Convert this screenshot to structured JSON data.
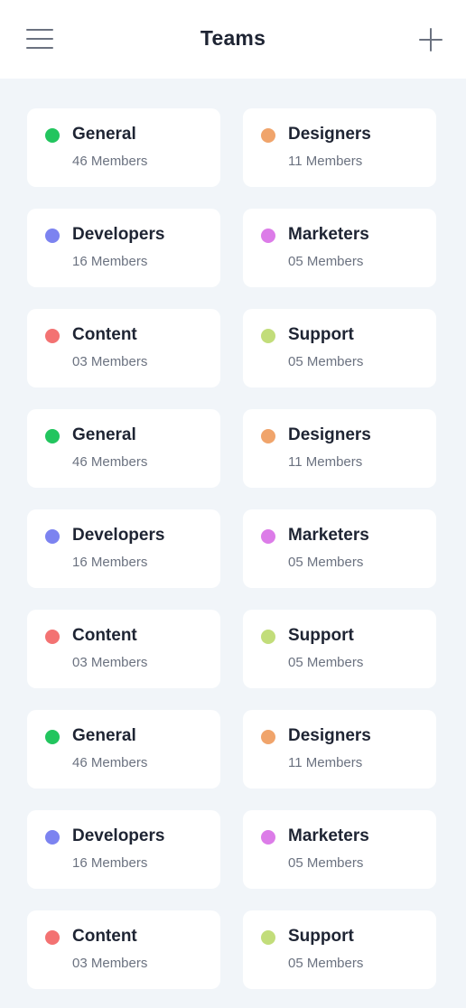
{
  "header": {
    "title": "Teams",
    "menu_icon": "hamburger-menu-icon",
    "add_icon": "plus-icon"
  },
  "teams": [
    {
      "name": "General",
      "members": "46 Members",
      "color": "#22c55e"
    },
    {
      "name": "Designers",
      "members": "11 Members",
      "color": "#f0a46b"
    },
    {
      "name": "Developers",
      "members": "16 Members",
      "color": "#7c83f0"
    },
    {
      "name": "Marketers",
      "members": "05 Members",
      "color": "#dc7ce8"
    },
    {
      "name": "Content",
      "members": "03 Members",
      "color": "#f37272"
    },
    {
      "name": "Support",
      "members": "05 Members",
      "color": "#c2dd7a"
    },
    {
      "name": "General",
      "members": "46 Members",
      "color": "#22c55e"
    },
    {
      "name": "Designers",
      "members": "11 Members",
      "color": "#f0a46b"
    },
    {
      "name": "Developers",
      "members": "16 Members",
      "color": "#7c83f0"
    },
    {
      "name": "Marketers",
      "members": "05 Members",
      "color": "#dc7ce8"
    },
    {
      "name": "Content",
      "members": "03 Members",
      "color": "#f37272"
    },
    {
      "name": "Support",
      "members": "05 Members",
      "color": "#c2dd7a"
    },
    {
      "name": "General",
      "members": "46 Members",
      "color": "#22c55e"
    },
    {
      "name": "Designers",
      "members": "11 Members",
      "color": "#f0a46b"
    },
    {
      "name": "Developers",
      "members": "16 Members",
      "color": "#7c83f0"
    },
    {
      "name": "Marketers",
      "members": "05 Members",
      "color": "#dc7ce8"
    },
    {
      "name": "Content",
      "members": "03 Members",
      "color": "#f37272"
    },
    {
      "name": "Support",
      "members": "05 Members",
      "color": "#c2dd7a"
    }
  ]
}
